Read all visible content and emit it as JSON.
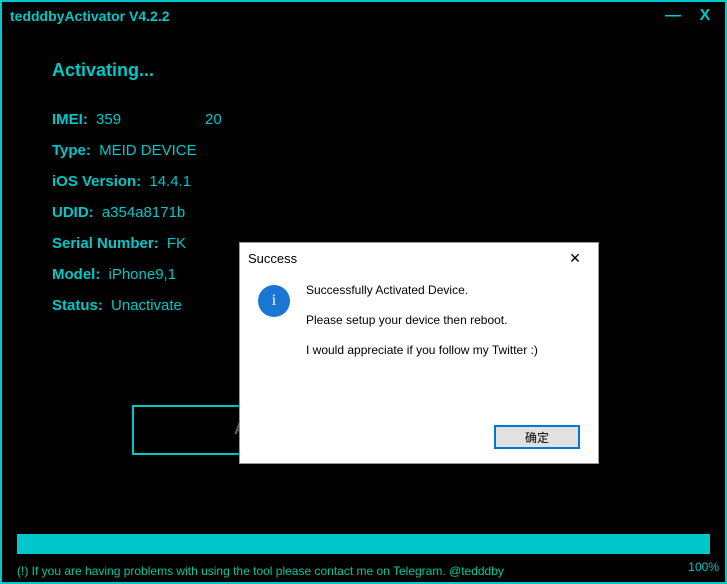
{
  "window": {
    "title": "tedddbyActivator V4.2.2",
    "minimize": "—",
    "close": "X"
  },
  "heading": "Activating...",
  "info": {
    "imei_label": "IMEI:",
    "imei_prefix": "359",
    "imei_suffix": "20",
    "type_label": "Type:",
    "type_value": "MEID DEVICE",
    "ios_label": "iOS Version:",
    "ios_value": "14.4.1",
    "udid_label": "UDID:",
    "udid_value": "a354a8171b",
    "serial_label": "Serial Number:",
    "serial_value": "FK",
    "model_label": "Model:",
    "model_value": "iPhone9,1",
    "status_label": "Status:",
    "status_value": "Unactivate"
  },
  "button": {
    "activate": "Activat"
  },
  "progress": {
    "percent": "100%"
  },
  "footer": "(!) If you are having problems with using the tool please contact me on Telegram. @tedddby",
  "dialog": {
    "title": "Success",
    "close": "✕",
    "line1": "Successfully Activated Device.",
    "line2": "Please setup your device then reboot.",
    "line3": "I would appreciate if you follow my Twitter :)",
    "ok": "确定",
    "icon_char": "i"
  }
}
